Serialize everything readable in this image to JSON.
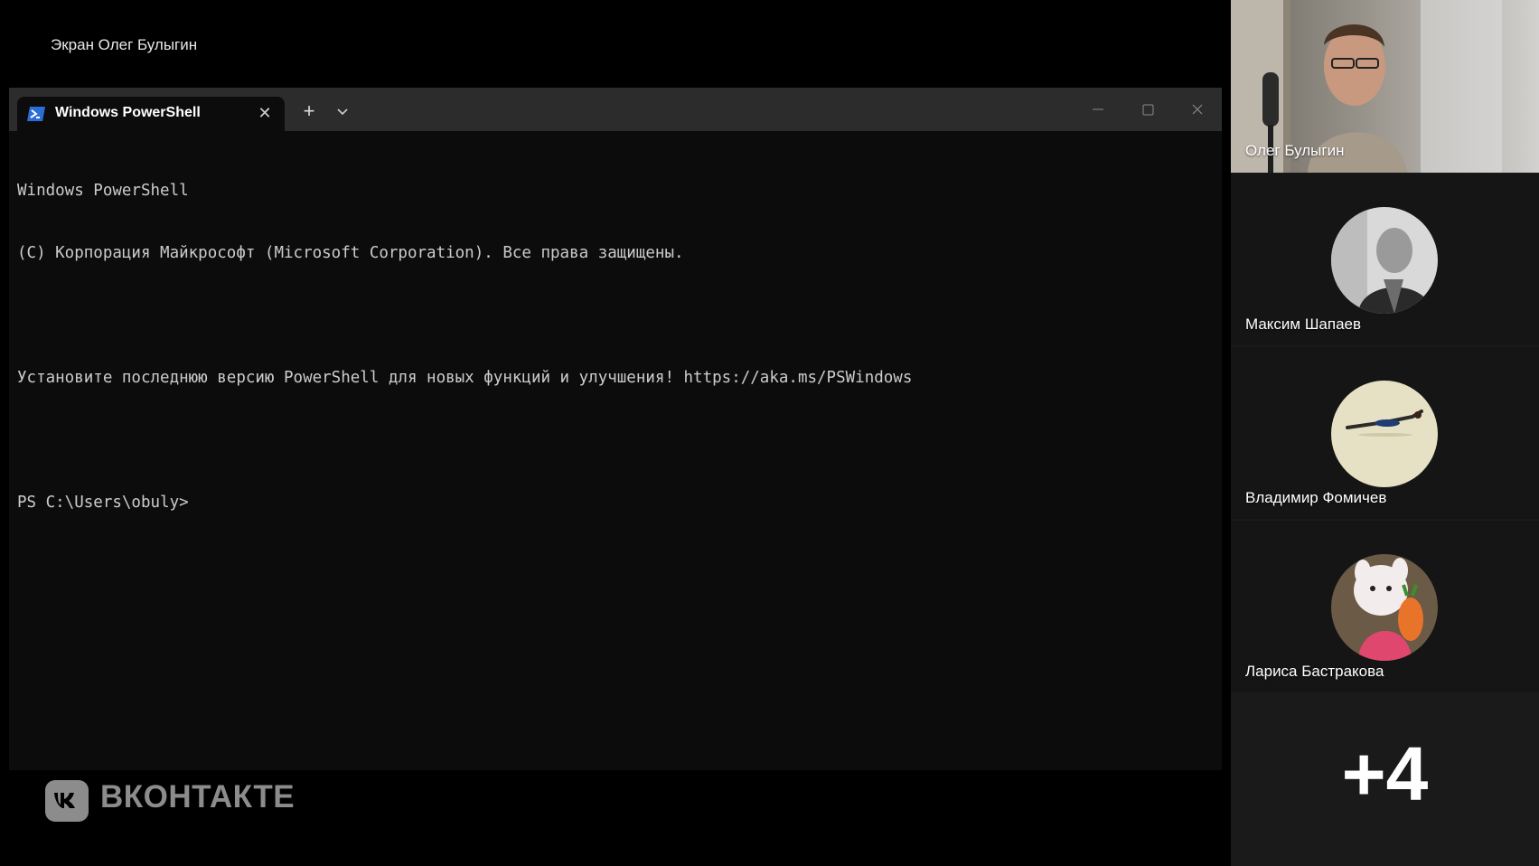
{
  "screen_share": {
    "label": "Экран Олег Булыгин"
  },
  "terminal": {
    "tab_title": "Windows PowerShell",
    "tab_icon": "powershell-icon",
    "lines": [
      "Windows PowerShell",
      "(C) Корпорация Майкрософт (Microsoft Corporation). Все права защищены.",
      "",
      "Установите последнюю версию PowerShell для новых функций и улучшения! https://aka.ms/PSWindows",
      "",
      "PS C:\\Users\\obuly>"
    ],
    "colors": {
      "background": "#0c0c0c",
      "titlebar": "#2c2c2c",
      "text": "#cccccc"
    }
  },
  "branding": {
    "logo_text": "ВКОНТАКТЕ",
    "logo_icon": "vk-icon"
  },
  "participants": [
    {
      "name": "Олег Булыгин",
      "type": "video"
    },
    {
      "name": "Максим Шапаев",
      "type": "avatar"
    },
    {
      "name": "Владимир Фомичев",
      "type": "avatar"
    },
    {
      "name": "Лариса Бастракова",
      "type": "avatar"
    }
  ],
  "more_participants": "+4"
}
